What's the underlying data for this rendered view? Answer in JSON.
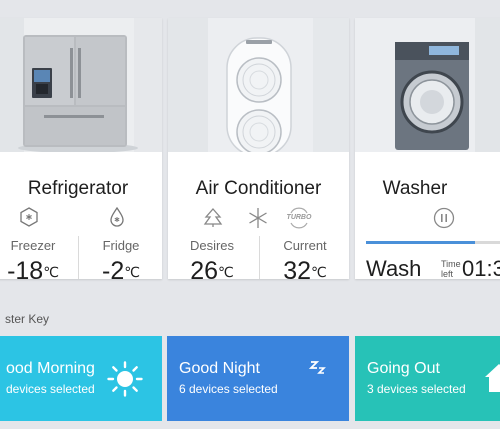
{
  "devices": {
    "refrigerator": {
      "name": "Refrigerator",
      "freezer": {
        "label": "Freezer",
        "value": "-18",
        "unit": "℃"
      },
      "fridge": {
        "label": "Fridge",
        "value": "-2",
        "unit": "℃"
      }
    },
    "air_conditioner": {
      "name": "Air Conditioner",
      "desired": {
        "label": "Desires",
        "value": "26",
        "unit": "℃"
      },
      "current": {
        "label": "Current",
        "value": "32",
        "unit": "℃"
      },
      "turbo_label": "TURBO"
    },
    "washer": {
      "name": "Washer",
      "progress": 0.78,
      "cycle": "Wash",
      "time_left_line1": "Time",
      "time_left_line2": "left",
      "time_left_value": "01:3"
    }
  },
  "master_key": {
    "label": "ster Key",
    "modes": [
      {
        "title": "ood Morning",
        "subtitle": "devices selected"
      },
      {
        "title": "Good Night",
        "subtitle": "6 devices selected"
      },
      {
        "title": "Going Out",
        "subtitle": "3 devices selected"
      }
    ]
  },
  "colors": {
    "background": "#e4e6ea",
    "morning": "#2cc4e4",
    "night": "#3a84dd",
    "going_out": "#27c2b7",
    "progress": "#4a90d9"
  }
}
